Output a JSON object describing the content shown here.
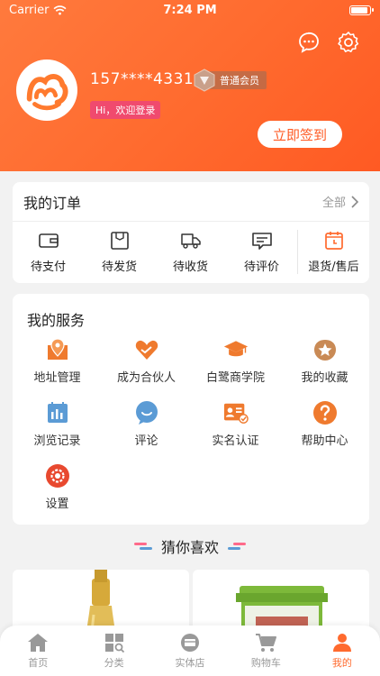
{
  "status": {
    "carrier": "Carrier",
    "time": "7:24 PM"
  },
  "profile": {
    "phone": "157****4331",
    "member_level": "普通会员",
    "welcome": "Hi，欢迎登录",
    "signin_label": "立即签到"
  },
  "orders": {
    "title": "我的订单",
    "all_label": "全部",
    "items": [
      {
        "label": "待支付",
        "icon": "wallet-icon"
      },
      {
        "label": "待发货",
        "icon": "box-icon"
      },
      {
        "label": "待收货",
        "icon": "truck-icon"
      },
      {
        "label": "待评价",
        "icon": "comment-icon"
      },
      {
        "label": "退货/售后",
        "icon": "return-icon"
      }
    ]
  },
  "services": {
    "title": "我的服务",
    "items": [
      {
        "label": "地址管理",
        "icon": "location-icon"
      },
      {
        "label": "成为合伙人",
        "icon": "partner-icon"
      },
      {
        "label": "白鹭商学院",
        "icon": "graduation-icon"
      },
      {
        "label": "我的收藏",
        "icon": "star-icon"
      },
      {
        "label": "浏览记录",
        "icon": "calendar-icon"
      },
      {
        "label": "评论",
        "icon": "chat-icon"
      },
      {
        "label": "实名认证",
        "icon": "id-card-icon"
      },
      {
        "label": "帮助中心",
        "icon": "help-icon"
      },
      {
        "label": "设置",
        "icon": "settings-icon"
      }
    ]
  },
  "recommend": {
    "title": "猜你喜欢"
  },
  "tabs": [
    {
      "label": "首页",
      "icon": "home-icon"
    },
    {
      "label": "分类",
      "icon": "category-icon"
    },
    {
      "label": "实体店",
      "icon": "store-icon"
    },
    {
      "label": "购物车",
      "icon": "cart-icon"
    },
    {
      "label": "我的",
      "icon": "user-icon"
    }
  ],
  "colors": {
    "accent": "#ff6a2e",
    "service_orange": "#ef7a2e",
    "service_blue": "#5b9bd5",
    "badge_pink": "#f04a6e"
  }
}
